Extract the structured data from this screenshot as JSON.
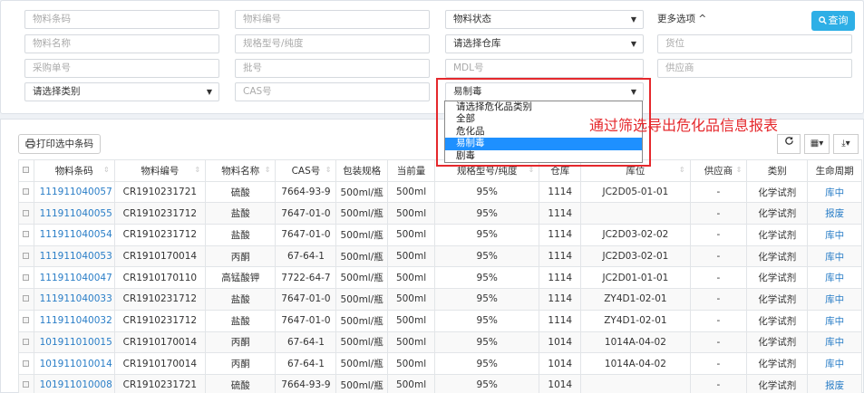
{
  "filters": {
    "material_barcode": "物料条码",
    "material_no": "物料编号",
    "material_status": "物料状态",
    "more_options": "更多选项 ^",
    "query_label": "查询",
    "material_name": "物料名称",
    "spec": "规格型号/纯度",
    "warehouse": "请选择仓库",
    "location": "货位",
    "purchase_no": "采购单号",
    "batch_no": "批号",
    "mdl_no": "MDL号",
    "supplier": "供应商",
    "category": "请选择类别",
    "cas_no": "CAS号",
    "hazard_selected": "易制毒"
  },
  "hazard_dropdown": {
    "options": [
      "请选择危化品类别",
      "全部",
      "危化品",
      "易制毒",
      "剧毒"
    ],
    "selected_index": 3
  },
  "annotation": "通过筛选导出危化品信息报表",
  "toolbar": {
    "print_label": "打印选中条码"
  },
  "table": {
    "headers": [
      "物料条码",
      "物料编号",
      "物料名称",
      "CAS号",
      "包装规格",
      "当前量",
      "规格型号/纯度",
      "仓库",
      "库位",
      "供应商",
      "类别",
      "生命周期"
    ],
    "rows": [
      [
        "111911040057",
        "CR1910231721",
        "硫酸",
        "7664-93-9",
        "500ml/瓶",
        "500ml",
        "95%",
        "1114",
        "JC2D05-01-01",
        "-",
        "化学试剂",
        "库中"
      ],
      [
        "111911040055",
        "CR1910231712",
        "盐酸",
        "7647-01-0",
        "500ml/瓶",
        "500ml",
        "95%",
        "1114",
        "",
        "-",
        "化学试剂",
        "报废"
      ],
      [
        "111911040054",
        "CR1910231712",
        "盐酸",
        "7647-01-0",
        "500ml/瓶",
        "500ml",
        "95%",
        "1114",
        "JC2D03-02-02",
        "-",
        "化学试剂",
        "库中"
      ],
      [
        "111911040053",
        "CR1910170014",
        "丙酮",
        "67-64-1",
        "500ml/瓶",
        "500ml",
        "95%",
        "1114",
        "JC2D03-02-01",
        "-",
        "化学试剂",
        "库中"
      ],
      [
        "111911040047",
        "CR1910170110",
        "高锰酸钾",
        "7722-64-7",
        "500ml/瓶",
        "500ml",
        "95%",
        "1114",
        "JC2D01-01-01",
        "-",
        "化学试剂",
        "库中"
      ],
      [
        "111911040033",
        "CR1910231712",
        "盐酸",
        "7647-01-0",
        "500ml/瓶",
        "500ml",
        "95%",
        "1114",
        "ZY4D1-02-01",
        "-",
        "化学试剂",
        "库中"
      ],
      [
        "111911040032",
        "CR1910231712",
        "盐酸",
        "7647-01-0",
        "500ml/瓶",
        "500ml",
        "95%",
        "1114",
        "ZY4D1-02-01",
        "-",
        "化学试剂",
        "库中"
      ],
      [
        "101911010015",
        "CR1910170014",
        "丙酮",
        "67-64-1",
        "500ml/瓶",
        "500ml",
        "95%",
        "1014",
        "1014A-04-02",
        "-",
        "化学试剂",
        "库中"
      ],
      [
        "101911010014",
        "CR1910170014",
        "丙酮",
        "67-64-1",
        "500ml/瓶",
        "500ml",
        "95%",
        "1014",
        "1014A-04-02",
        "-",
        "化学试剂",
        "库中"
      ],
      [
        "101911010008",
        "CR1910231721",
        "硫酸",
        "7664-93-9",
        "500ml/瓶",
        "500ml",
        "95%",
        "1014",
        "",
        "-",
        "化学试剂",
        "报废"
      ]
    ]
  },
  "colors": {
    "link": "#2a7ec7",
    "query_button": "#2eafe6",
    "highlight": "#e5282c",
    "dropdown_selected": "#1e90ff"
  }
}
